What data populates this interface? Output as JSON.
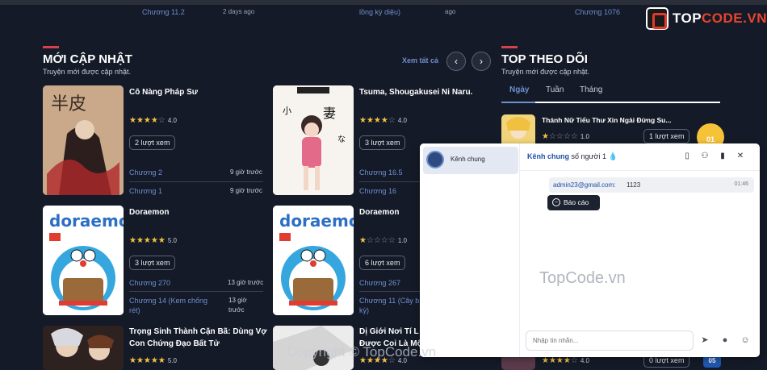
{
  "top_fragments": {
    "chapter_left": "Chương 11.2",
    "time_left": "2 days ago",
    "title_mid": "lồng kỳ diệu)",
    "time_mid": "ago",
    "chapter_right": "Chương 1076"
  },
  "logo": {
    "prefix": "TOP",
    "suffix": "CODE.VN"
  },
  "latest": {
    "title": "MỚI CẬP NHẬT",
    "subtitle": "Truyện mới được cập nhật.",
    "view_all": "Xem tất cả",
    "prev_icon": "chevron-left-icon",
    "next_icon": "chevron-right-icon",
    "prev": "‹",
    "next": "›",
    "items": [
      {
        "title": "Cô Nàng Pháp Sư",
        "rating": "4.0",
        "stars": 4,
        "views": "2 lượt xem",
        "ch1": "Chương 2",
        "t1": "9 giờ trước",
        "ch2": "Chương 1",
        "t2": "9 giờ trước"
      },
      {
        "title": "Tsuma, Shougakusei Ni Naru.",
        "rating": "4.0",
        "stars": 4,
        "views": "3 lượt xem",
        "ch1": "Chương 16.5",
        "t1": "",
        "ch2": "Chương 16",
        "t2": ""
      },
      {
        "title": "Doraemon",
        "rating": "5.0",
        "stars": 5,
        "views": "3 lượt xem",
        "ch1": "Chương 270",
        "t1": "13 giờ trước",
        "ch2": "Chương 14 (Kem chống rét)",
        "t2": "13 giờ trước"
      },
      {
        "title": "Doraemon",
        "rating": "1.0",
        "stars": 1,
        "views": "6 lượt xem",
        "ch1": "Chương 267",
        "t1": "",
        "ch2": "Chương 11 (Cây b kỳ)",
        "t2": ""
      },
      {
        "title": "Trọng Sinh Thành Cặn Bã: Dùng Vợ Con Chứng Đạo Bất Tử",
        "rating": "5.0",
        "stars": 5
      },
      {
        "title": "Dị Giới Nơi Tí L Được Coi Là Mộ",
        "rating": "4.0",
        "stars": 4
      }
    ]
  },
  "top_follow": {
    "title": "TOP THEO DÕI",
    "subtitle": "Truyện mới được cập nhật.",
    "tabs": [
      "Ngày",
      "Tuần",
      "Tháng"
    ],
    "item_title": "Thánh Nữ Tiểu Thư Xin Ngài Đừng Su...",
    "item_rating": "1.0",
    "item_views": "1 lượt xem",
    "rank1": "01",
    "bottom_rating": "4.0",
    "bottom_views": "0 lượt xem",
    "rank5": "05"
  },
  "chat": {
    "channel": "Kênh chung",
    "header_prefix": "Kênh chung",
    "header_count": "số người 1",
    "icons": [
      "phone-icon",
      "user-remove-icon",
      "trash-icon",
      "close-icon"
    ],
    "message": {
      "user": "admin23@gmail.com:",
      "text": "1123",
      "time": "01:46"
    },
    "report": "Báo cáo",
    "input_placeholder": "Nhập tin nhắn...",
    "footer_icons": [
      "send-icon",
      "microphone-icon",
      "emoji-icon"
    ]
  },
  "watermark": "TopCode.vn",
  "copyright": "Copyright © TopCode.vn"
}
